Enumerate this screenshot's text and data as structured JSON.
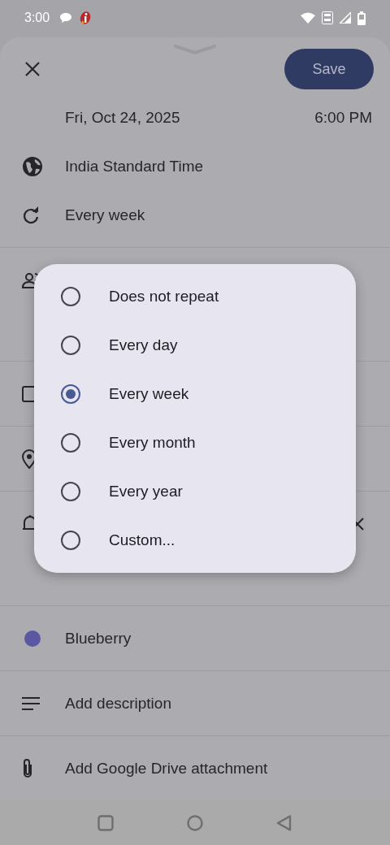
{
  "status_bar": {
    "time": "3:00"
  },
  "toolbar": {
    "save_label": "Save"
  },
  "event": {
    "date": "Fri, Oct 24, 2025",
    "time": "6:00 PM",
    "timezone": "India Standard Time",
    "repeat": "Every week",
    "calendar_color": {
      "name": "Blueberry",
      "color": "#5b57a2"
    },
    "description": "Add description",
    "attachment": "Add Google Drive attachment"
  },
  "repeat_dialog": {
    "options": [
      {
        "label": "Does not repeat",
        "selected": false
      },
      {
        "label": "Every day",
        "selected": false
      },
      {
        "label": "Every week",
        "selected": true
      },
      {
        "label": "Every month",
        "selected": false
      },
      {
        "label": "Every year",
        "selected": false
      },
      {
        "label": "Custom...",
        "selected": false
      }
    ]
  }
}
